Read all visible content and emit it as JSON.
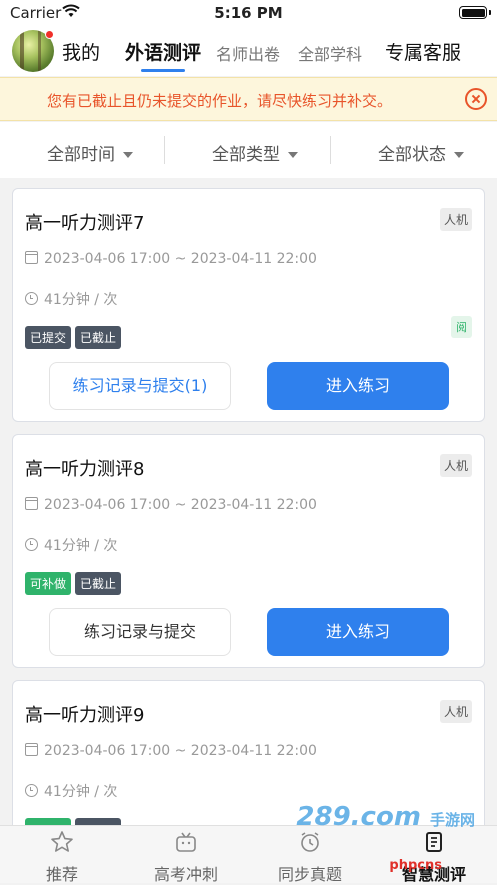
{
  "status": {
    "carrier": "Carrier",
    "time": "5:16 PM"
  },
  "nav": {
    "my": "我的",
    "tabs": [
      {
        "label": "外语测评"
      },
      {
        "label": "名师出卷"
      },
      {
        "label": "全部学科"
      },
      {
        "label": "专属客服"
      }
    ]
  },
  "notice": {
    "text": "您有已截止且仍未提交的作业，请尽快练习并补交。"
  },
  "filters": [
    {
      "label": "全部时间"
    },
    {
      "label": "全部类型"
    },
    {
      "label": "全部状态"
    }
  ],
  "cards": [
    {
      "title": "高一听力测评7",
      "type_tag": "人机",
      "time_range": "2023-04-06 17:00 ~ 2023-04-11 22:00",
      "duration": "41分钟 / 次",
      "badges": [
        "已提交",
        "已截止"
      ],
      "read_flag": "阅",
      "record_label": "练习记录与提交(1)",
      "enter_label": "进入练习"
    },
    {
      "title": "高一听力测评8",
      "type_tag": "人机",
      "time_range": "2023-04-06 17:00 ~ 2023-04-11 22:00",
      "duration": "41分钟 / 次",
      "badges": [
        "可补做",
        "已截止"
      ],
      "record_label": "练习记录与提交",
      "enter_label": "进入练习"
    },
    {
      "title": "高一听力测评9",
      "type_tag": "人机",
      "time_range": "2023-04-06 17:00 ~ 2023-04-11 22:00",
      "duration": "41分钟 / 次"
    }
  ],
  "tabbar": [
    {
      "label": "推荐",
      "icon": "star-icon"
    },
    {
      "label": "高考冲刺",
      "icon": "tv-icon"
    },
    {
      "label": "同步真题",
      "icon": "clock-icon"
    },
    {
      "label": "智慧测评",
      "icon": "document-icon"
    }
  ],
  "watermark": {
    "main": "289.com",
    "sub": "手游网",
    "site": "phpcns"
  },
  "colors": {
    "accent": "#2f80ed",
    "notice": "#e8542a",
    "green": "#2fb36b"
  }
}
